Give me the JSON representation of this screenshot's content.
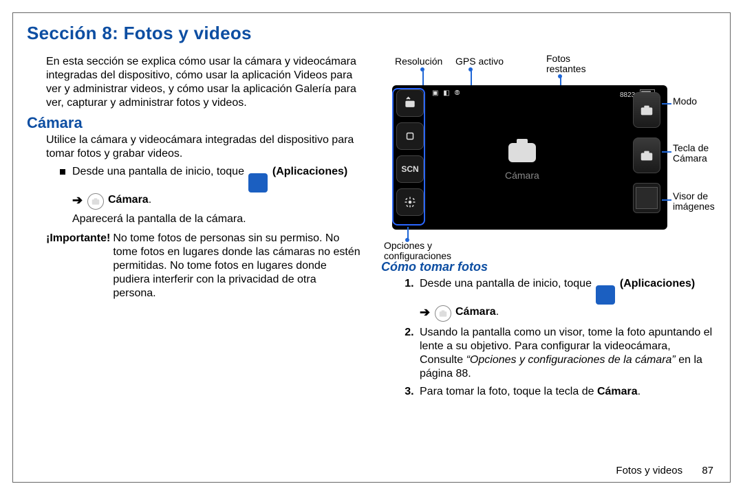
{
  "title": "Sección 8: Fotos y videos",
  "intro": "En esta sección se explica cómo usar la cámara y videocámara integradas del dispositivo, cómo usar la aplicación Videos para ver y administrar videos, y cómo usar la aplicación Galería para ver, capturar y administrar fotos y videos.",
  "camara": {
    "heading": "Cámara",
    "lead": "Utilice la cámara y videocámara integradas del dispositivo para tomar fotos y grabar videos.",
    "step_prefix": "Desde una pantalla de inicio, toque ",
    "apps_label": "(Aplicaciones)",
    "arrow": "➔",
    "camara_label": "Cámara",
    "after": "Aparecerá la pantalla de la cámara."
  },
  "important": {
    "label": "¡Importante! ",
    "body": "No tome fotos de personas sin su permiso. No tome fotos en lugares donde las cámaras no estén permitidas. No tome fotos en lugares donde pudiera interferir con la privacidad de otra persona."
  },
  "diagram": {
    "labels": {
      "resolucion": "Resolución",
      "gps": "GPS activo",
      "fotos_restantes": "Fotos restantes",
      "modo": "Modo",
      "tecla_camara": "Tecla de Cámara",
      "visor": "Visor de imágenes",
      "opciones": "Opciones y configuraciones",
      "center": "Cámara",
      "scn": "SCN",
      "count": "8823"
    }
  },
  "howto": {
    "heading": "Cómo tomar fotos",
    "steps": {
      "s1_prefix": "Desde una pantalla de inicio, toque ",
      "s1_apps": "(Aplicaciones)",
      "s1_arrow": "➔",
      "s1_cam": "Cámara",
      "s2a": "Usando la pantalla como un visor, tome la foto apuntando el lente a su objetivo. Para configurar la videocámara, Consulte ",
      "s2_ref": "“Opciones y configuraciones de la cámara”",
      "s2b": " en la página 88.",
      "s3a": "Para tomar la foto, toque la tecla de ",
      "s3b": "Cámara"
    }
  },
  "footer": {
    "section": "Fotos y videos",
    "page": "87"
  }
}
